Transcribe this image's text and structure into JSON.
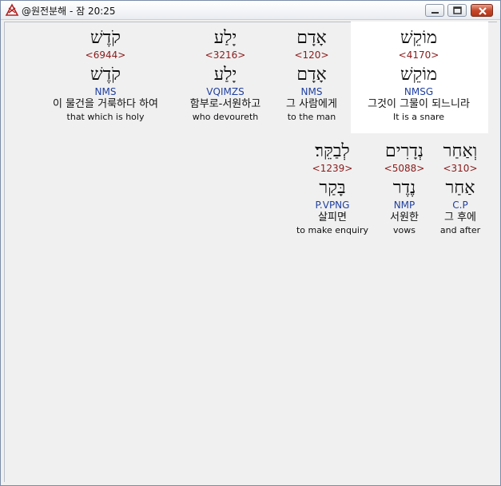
{
  "window": {
    "title": "@원전분해 - 잠 20:25",
    "buttons": {
      "minimize": "minimize",
      "maximize": "maximize",
      "close": "close"
    }
  },
  "rows": [
    {
      "words": [
        {
          "hebrew": "מוֹקֵשׁ",
          "strong": "<4170>",
          "lemma": "מוֹקֵשׁ",
          "morph": "NMSG",
          "korean": "그것이 그물이 되느니라",
          "english": "It is a snare"
        },
        {
          "hebrew": "אָדָם",
          "strong": "<120>",
          "lemma": "אָדָם",
          "morph": "NMS",
          "korean": "그 사람에게",
          "english": "to the man"
        },
        {
          "hebrew": "יָלַע",
          "strong": "<3216>",
          "lemma": "יָלַע",
          "morph": "VQIMZS",
          "korean": "함부로-서원하고",
          "english": "who devoureth"
        },
        {
          "hebrew": "קֹדֶשׁ",
          "strong": "<6944>",
          "lemma": "קֹדֶשׁ",
          "morph": "NMS",
          "korean": "이 물건을 거룩하다 하여",
          "english": "that which is holy"
        }
      ]
    },
    {
      "words": [
        {
          "hebrew": "וְאַחַר",
          "strong": "<310>",
          "lemma": "אַחַר",
          "morph": "C.P",
          "korean": "그 후에",
          "english": "and after"
        },
        {
          "hebrew": "נְדָרִים",
          "strong": "<5088>",
          "lemma": "נֶדֶר",
          "morph": "NMP",
          "korean": "서원한",
          "english": "vows"
        },
        {
          "hebrew": "לְבַקֵּר׃",
          "strong": "<1239>",
          "lemma": "בָּקַר",
          "morph": "P.VPNG",
          "korean": "살피면",
          "english": "to make enquiry"
        }
      ]
    }
  ]
}
